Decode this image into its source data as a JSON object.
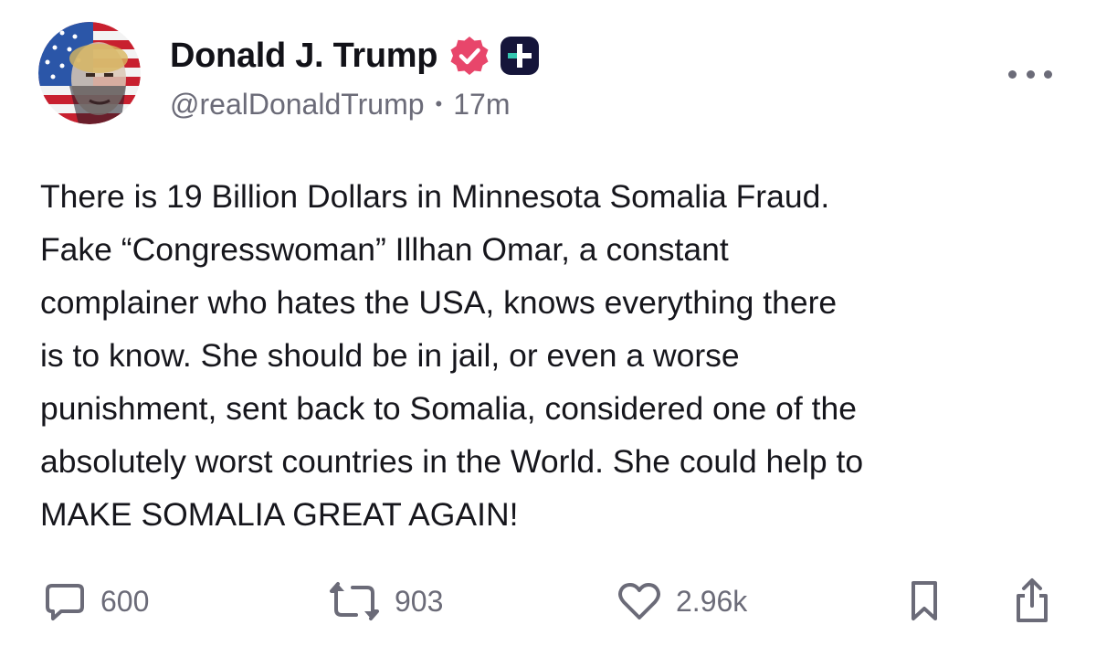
{
  "author": {
    "display_name": "Donald J. Trump",
    "handle": "@realDonaldTrump",
    "separator": "•",
    "time_ago": "17m",
    "verified_icon": "verified-badge-icon",
    "plus_icon": "plus-badge-icon"
  },
  "post": {
    "lines": [
      "There is 19 Billion Dollars in Minnesota Somalia Fraud.",
      "Fake “Congresswoman” Illhan Omar, a constant",
      "complainer who hates the USA, knows everything there",
      "is to know. She should be in jail, or even a worse",
      "punishment, sent back to Somalia, considered one of the",
      "absolutely worst countries in the World. She could help to",
      "MAKE SOMALIA GREAT AGAIN!"
    ]
  },
  "actions": {
    "replies": "600",
    "reposts": "903",
    "likes": "2.96k"
  },
  "colors": {
    "badge_pink": "#e8466b",
    "plus_dark": "#15153a",
    "plus_teal": "#34c6b0",
    "muted": "#6b6b78",
    "text": "#16161c"
  }
}
